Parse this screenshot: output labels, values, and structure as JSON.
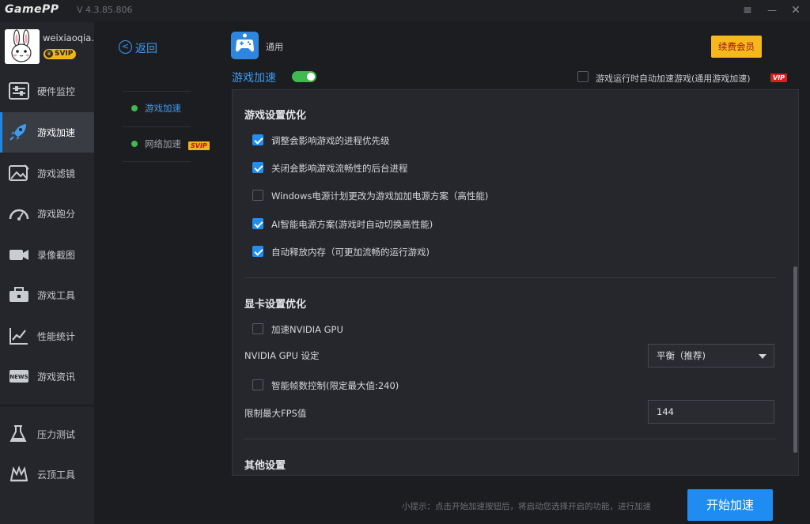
{
  "app": {
    "logo": "GamePP",
    "version": "V 4.3.85.806"
  },
  "window_controls": {
    "menu_icon": "≡",
    "minimize_icon": "—",
    "close_icon": "✕"
  },
  "profile": {
    "username": "weixiaoqia..",
    "badge": "SVIP"
  },
  "sidebar": {
    "items": [
      {
        "label": "硬件监控",
        "icon": "sliders-icon"
      },
      {
        "label": "游戏加速",
        "icon": "rocket-icon",
        "active": true
      },
      {
        "label": "游戏滤镜",
        "icon": "image-filter-icon"
      },
      {
        "label": "游戏跑分",
        "icon": "speedometer-icon"
      },
      {
        "label": "录像截图",
        "icon": "video-camera-icon"
      },
      {
        "label": "游戏工具",
        "icon": "toolbox-icon"
      },
      {
        "label": "性能统计",
        "icon": "chart-line-icon"
      },
      {
        "label": "游戏资讯",
        "icon": "news-icon"
      },
      {
        "label": "压力测试",
        "icon": "flask-icon"
      },
      {
        "label": "云顶工具",
        "icon": "crown-tool-icon"
      }
    ]
  },
  "submenu": {
    "back_label": "返回",
    "items": [
      {
        "label": "游戏加速",
        "active": true
      },
      {
        "label": "网络加速",
        "badge": "SVIP"
      }
    ]
  },
  "header": {
    "general_label": "通用",
    "renew_label": "续费会员",
    "accel_title": "游戏加速",
    "accel_enabled": true,
    "auto_accel_label": "游戏运行时自动加速游戏(通用游戏加速)",
    "auto_accel_checked": false,
    "vip_badge": "VIP"
  },
  "panel": {
    "game_section": {
      "title": "游戏设置优化",
      "options": [
        {
          "label": "调整会影响游戏的进程优先级",
          "checked": true
        },
        {
          "label": "关闭会影响游戏流畅性的后台进程",
          "checked": true
        },
        {
          "label": "Windows电源计划更改为游戏加加电源方案（高性能)",
          "checked": false
        },
        {
          "label": "AI智能电源方案(游戏时自动切换高性能)",
          "checked": true
        },
        {
          "label": "自动释放内存（可更加流畅的运行游戏)",
          "checked": true
        }
      ]
    },
    "gpu_section": {
      "title": "显卡设置优化",
      "nvidia_accel_label": "加速NVIDIA GPU",
      "nvidia_accel_checked": false,
      "gpu_setting_label": "NVIDIA GPU 设定",
      "gpu_setting_value": "平衡（推荐)",
      "fps_control_label": "智能帧数控制(限定最大值:240)",
      "fps_control_checked": false,
      "max_fps_label": "限制最大FPS值",
      "max_fps_value": "144"
    },
    "other_section": {
      "title": "其他设置"
    }
  },
  "footer": {
    "hint": "小提示：点击开始加速按钮后，将启动您选择开启的功能，进行加速",
    "start_label": "开始加速"
  },
  "colors": {
    "accent": "#1e8cf0",
    "active_green": "#3fb950",
    "vip_gold": "#f6b91c",
    "background": "#1c1d21"
  }
}
